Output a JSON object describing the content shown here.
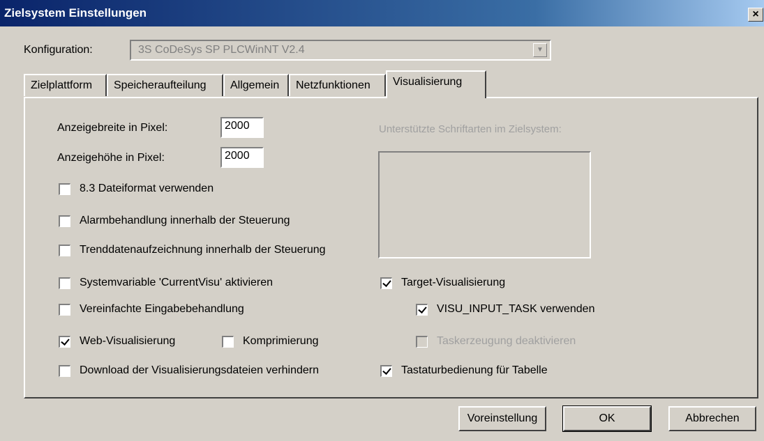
{
  "window": {
    "title": "Zielsystem Einstellungen",
    "close_glyph": "×"
  },
  "config": {
    "label": "Konfiguration:",
    "value": "3S CoDeSys SP PLCWinNT V2.4"
  },
  "tabs": [
    "Zielplattform",
    "Speicheraufteilung",
    "Allgemein",
    "Netzfunktionen",
    "Visualisierung"
  ],
  "active_tab": "Visualisierung",
  "fields": {
    "width_label": "Anzeigebreite in Pixel:",
    "width_value": "2000",
    "height_label": "Anzeigehöhe in Pixel:",
    "height_value": "2000"
  },
  "fonts_label": "Unterstützte Schriftarten im Zielsystem:",
  "checkboxes": {
    "dateiformat": {
      "label": "8.3 Dateiformat verwenden",
      "checked": false
    },
    "alarm": {
      "label": "Alarmbehandlung innerhalb der Steuerung",
      "checked": false
    },
    "trend": {
      "label": "Trenddatenaufzeichnung innerhalb der Steuerung",
      "checked": false
    },
    "currentvisu": {
      "label": "Systemvariable 'CurrentVisu' aktivieren",
      "checked": false
    },
    "eingabe": {
      "label": "Vereinfachte Eingabebehandlung",
      "checked": false
    },
    "webvisu": {
      "label": "Web-Visualisierung",
      "checked": true
    },
    "komprimierung": {
      "label": "Komprimierung",
      "checked": false
    },
    "download": {
      "label": "Download der Visualisierungsdateien verhindern",
      "checked": false
    },
    "targetvisu": {
      "label": "Target-Visualisierung",
      "checked": true
    },
    "visu_input_task": {
      "label": "VISU_INPUT_TASK verwenden",
      "checked": true
    },
    "taskerzeugung": {
      "label": "Taskerzeugung deaktivieren",
      "checked": false,
      "disabled": true
    },
    "tastatur": {
      "label": "Tastaturbedienung für Tabelle",
      "checked": true
    }
  },
  "buttons": {
    "defaults": "Voreinstellung",
    "ok": "OK",
    "cancel": "Abbrechen"
  }
}
